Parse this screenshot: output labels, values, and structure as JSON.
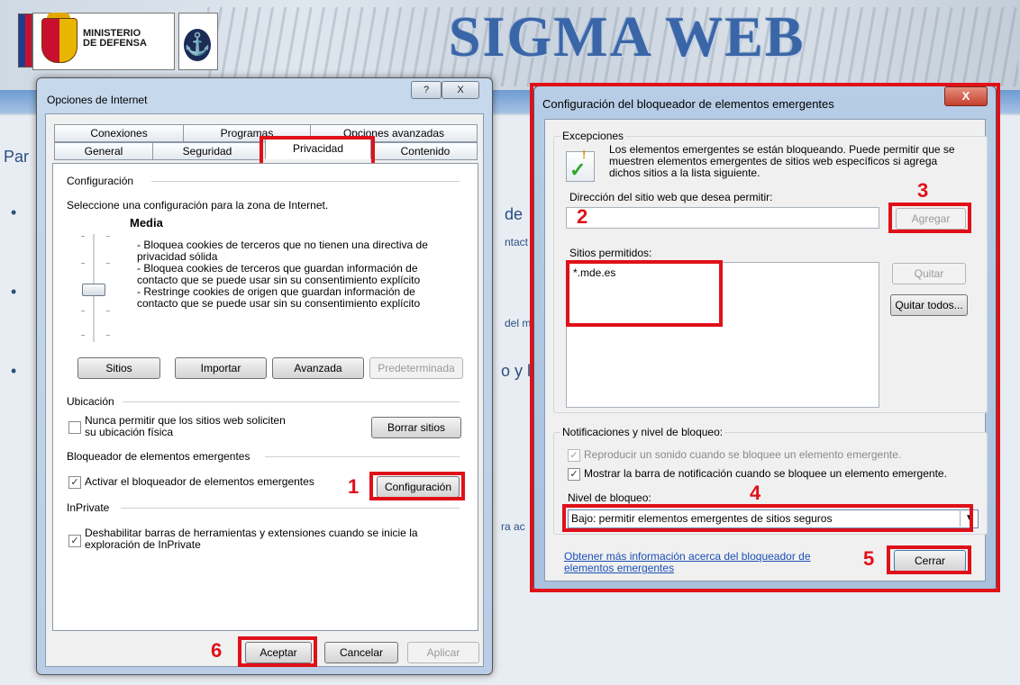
{
  "banner": {
    "ministerio": "MINISTERIO",
    "defensa": "DE DEFENSA",
    "sigma_title": "SIGMA WEB"
  },
  "page_fragments": {
    "par": "Par",
    "de": "de",
    "ntact": "ntact",
    "del_m": "del m",
    "o_y": "o y l",
    "ra_ac": "ra ac"
  },
  "options_dialog": {
    "title": "Opciones de Internet",
    "help_btn": "?",
    "close_btn": "X",
    "tabs_back": [
      "Conexiones",
      "Programas",
      "Opciones avanzadas"
    ],
    "tabs_front": [
      "General",
      "Seguridad",
      "Privacidad",
      "Contenido"
    ],
    "config_label": "Configuración",
    "config_desc": "Seleccione una configuración para la zona de Internet.",
    "level_title": "Media",
    "level_desc": [
      "- Bloquea cookies de terceros que no tienen una directiva de",
      "privacidad sólida",
      "- Bloquea cookies de terceros que guardan información de",
      "contacto que se puede usar sin su consentimiento explícito",
      "- Restringe cookies de origen que guardan información de",
      "contacto que se  puede usar sin su consentimiento explícito"
    ],
    "btn_sitios": "Sitios",
    "btn_importar": "Importar",
    "btn_avanzada": "Avanzada",
    "btn_predeterminada": "Predeterminada",
    "ubicacion_label": "Ubicación",
    "ubicacion_check_1": "Nunca permitir que los sitios web soliciten",
    "ubicacion_check_2": "su ubicación física",
    "btn_borrar": "Borrar sitios",
    "popup_label": "Bloqueador de elementos emergentes",
    "popup_check": "Activar el bloqueador de elementos emergentes",
    "btn_configuracion": "Configuración",
    "inprivate_label": "InPrivate",
    "inprivate_check_1": "Deshabilitar barras de herramientas y extensiones cuando se inicie la",
    "inprivate_check_2": "exploración de InPrivate",
    "btn_aceptar": "Aceptar",
    "btn_cancelar": "Cancelar",
    "btn_aplicar": "Aplicar"
  },
  "popup_dialog": {
    "title": "Configuración del bloqueador de elementos emergentes",
    "close_btn": "X",
    "excepciones_label": "Excepciones",
    "excepciones_desc": [
      "Los elementos emergentes se están bloqueando. Puede permitir que se",
      "muestren elementos emergentes de sitios web específicos si agrega",
      "dichos sitios a la lista siguiente."
    ],
    "address_label": "Dirección del sitio web que desea permitir:",
    "address_value": "",
    "btn_agregar": "Agregar",
    "allowed_label": "Sitios permitidos:",
    "allowed_sites": [
      "*.mde.es"
    ],
    "btn_quitar": "Quitar",
    "btn_quitar_todos": "Quitar todos...",
    "notif_label": "Notificaciones y nivel de bloqueo:",
    "notif_sound": "Reproducir un sonido cuando se bloquee un elemento emergente.",
    "notif_bar": "Mostrar la barra de notificación cuando se bloquee un elemento emergente.",
    "nivel_label": "Nivel de bloqueo:",
    "nivel_value": "Bajo: permitir elementos emergentes de sitios seguros",
    "info_link_1": "Obtener más información acerca del bloqueador de",
    "info_link_2": "elementos emergentes",
    "btn_cerrar": "Cerrar"
  },
  "step_numbers": [
    "1",
    "2",
    "3",
    "4",
    "5",
    "6"
  ],
  "colors": {
    "highlight_red": "#e01019",
    "banner_blue": "#3a66a8",
    "link_blue": "#1c4fb5"
  }
}
